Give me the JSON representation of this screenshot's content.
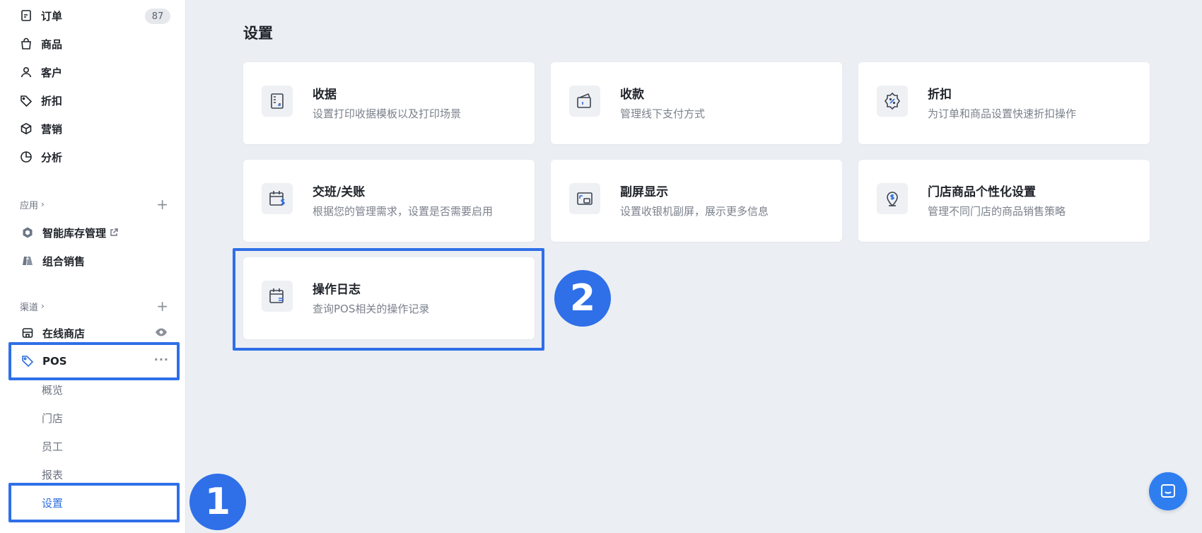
{
  "sidebar": {
    "nav": [
      {
        "label": "订单",
        "icon": "order-icon",
        "badge": "87"
      },
      {
        "label": "商品",
        "icon": "bag-icon"
      },
      {
        "label": "客户",
        "icon": "user-icon"
      },
      {
        "label": "折扣",
        "icon": "tag-icon"
      },
      {
        "label": "营销",
        "icon": "cube-icon"
      },
      {
        "label": "分析",
        "icon": "pie-chart-icon"
      }
    ],
    "apps_section": {
      "label": "应用",
      "chevron": "›",
      "add": "+"
    },
    "apps": [
      {
        "label": "智能库存管理",
        "icon": "inventory-icon",
        "external_icon": "external-link-icon"
      },
      {
        "label": "组合销售",
        "icon": "bundle-icon"
      }
    ],
    "channels_section": {
      "label": "渠道",
      "chevron": "›",
      "add": "+"
    },
    "channels": [
      {
        "label": "在线商店",
        "icon": "store-icon",
        "action_icon": "eye-icon"
      },
      {
        "label": "POS",
        "icon": "pos-tag-icon",
        "action": "···"
      }
    ],
    "pos_subitems": [
      {
        "label": "概览"
      },
      {
        "label": "门店"
      },
      {
        "label": "员工"
      },
      {
        "label": "报表"
      },
      {
        "label": "设置",
        "active": true
      }
    ]
  },
  "main": {
    "title": "设置",
    "cards": [
      {
        "title": "收据",
        "desc": "设置打印收据模板以及打印场景",
        "icon": "receipt-icon"
      },
      {
        "title": "收款",
        "desc": "管理线下支付方式",
        "icon": "wallet-icon"
      },
      {
        "title": "折扣",
        "desc": "为订单和商品设置快速折扣操作",
        "icon": "discount-badge-icon"
      },
      {
        "title": "交班/关账",
        "desc": "根据您的管理需求，设置是否需要启用",
        "icon": "calendar-dollar-icon"
      },
      {
        "title": "副屏显示",
        "desc": "设置收银机副屏，展示更多信息",
        "icon": "second-screen-icon"
      },
      {
        "title": "门店商品个性化设置",
        "desc": "管理不同门店的商品销售策略",
        "icon": "location-dollar-icon"
      },
      {
        "title": "操作日志",
        "desc": "查询POS相关的操作记录",
        "icon": "calendar-log-icon"
      }
    ]
  },
  "annotations": {
    "marker_1": "1",
    "marker_2": "2"
  },
  "colors": {
    "accent": "#2f6fe8",
    "active_text": "#2f6fe0",
    "background": "#ebeef3",
    "chat": "#2f7ef0"
  }
}
